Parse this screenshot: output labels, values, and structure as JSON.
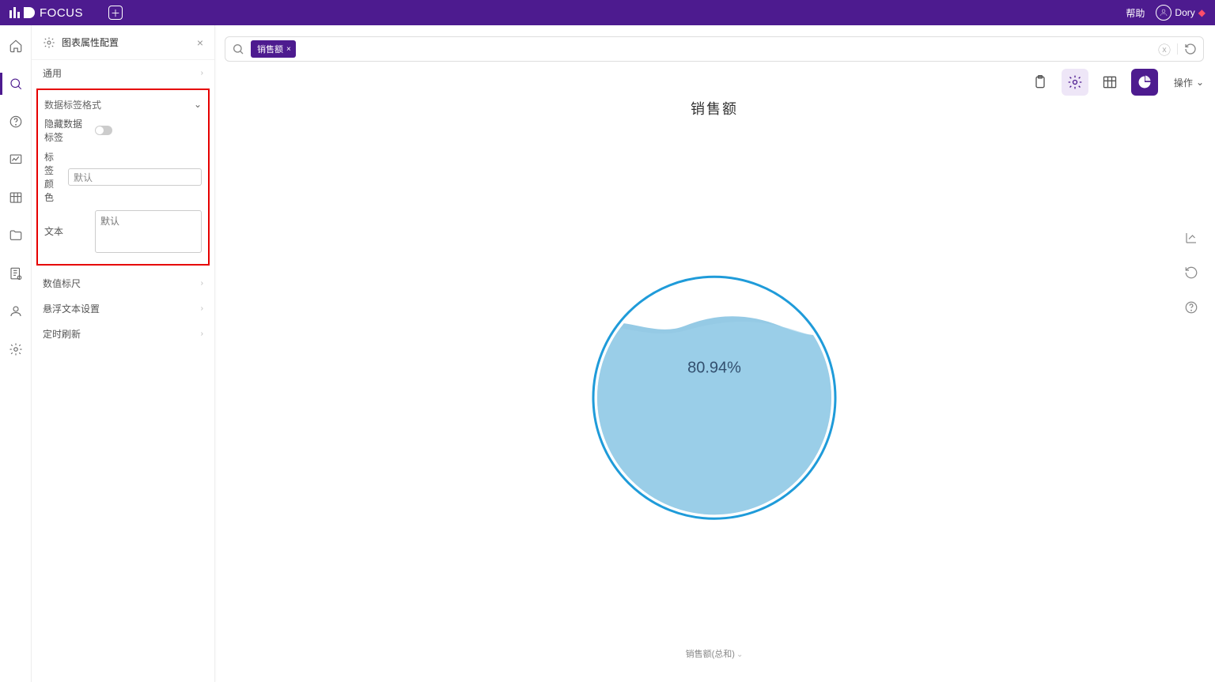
{
  "app": {
    "name": "FOCUS",
    "help": "帮助",
    "user": "Dory"
  },
  "config": {
    "title": "图表属性配置",
    "sections": {
      "general": "通用",
      "dataLabelFormat": "数据标签格式",
      "valueScale": "数值标尺",
      "hoverText": "悬浮文本设置",
      "autoRefresh": "定时刷新"
    },
    "form": {
      "hideDataLabel": "隐藏数据标签",
      "labelColor": "标签颜色",
      "labelColorValue": "默认",
      "text": "文本",
      "textPlaceholder": "默认"
    }
  },
  "search": {
    "chip": "销售额"
  },
  "toolbar": {
    "ops": "操作"
  },
  "chart": {
    "title": "销售额",
    "percentLabel": "80.94%",
    "bottomLabel": "销售额(总和)"
  },
  "chart_data": {
    "type": "pie",
    "title": "销售额",
    "series": [
      {
        "name": "销售额(总和)",
        "value": 80.94
      }
    ],
    "ylim": [
      0,
      100
    ],
    "percent": 80.94,
    "display": "liquid-fill"
  }
}
